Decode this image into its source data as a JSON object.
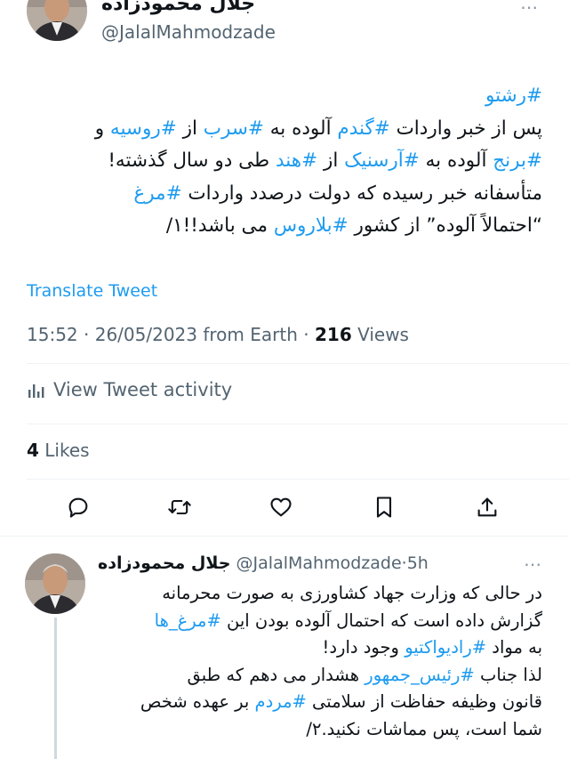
{
  "main_tweet": {
    "author_name": "جلال محمودزاده",
    "author_handle": "@JalalMahmodzade",
    "body_lines": [
      [
        {
          "t": "#رشتو",
          "tag": true
        }
      ],
      [
        {
          "t": "پس از خبر واردات "
        },
        {
          "t": "#گندم",
          "tag": true
        },
        {
          "t": " آلوده به "
        },
        {
          "t": "#سرب",
          "tag": true
        },
        {
          "t": " از "
        },
        {
          "t": "#روسیه",
          "tag": true
        },
        {
          "t": " و"
        }
      ],
      [
        {
          "t": "#برنج",
          "tag": true
        },
        {
          "t": " آلوده به "
        },
        {
          "t": "#آرسنیک",
          "tag": true
        },
        {
          "t": " از "
        },
        {
          "t": "#هند",
          "tag": true
        },
        {
          "t": " طی دو سال گذشته!"
        }
      ],
      [
        {
          "t": "متأسفانه خبر رسیده که دولت درصدد واردات "
        },
        {
          "t": "#مرغ",
          "tag": true
        }
      ],
      [
        {
          "t": "“احتمالاً آلوده” از کشور "
        },
        {
          "t": "#بلاروس",
          "tag": true
        },
        {
          "t": " می باشد!!۱/"
        }
      ]
    ],
    "translate_label": "Translate Tweet",
    "time": "15:52",
    "date": "26/05/2023",
    "source": "from Earth",
    "views_count": "216",
    "views_label": "Views",
    "activity_label": "View Tweet activity",
    "likes_count": "4",
    "likes_label": "Likes"
  },
  "actions": [
    "reply-icon",
    "retweet-icon",
    "like-icon",
    "bookmark-icon",
    "share-icon"
  ],
  "reply_tweet": {
    "author_name": "جلال محمودزاده",
    "author_handle": "@JalalMahmodzade",
    "time_ago": "5h",
    "body_lines": [
      [
        {
          "t": "در حالی که وزارت جهاد کشاورزی به صورت محرمانه"
        }
      ],
      [
        {
          "t": "گزارش داده است که احتمال آلوده بودن این "
        },
        {
          "t": "#مرغ_ها",
          "tag": true
        }
      ],
      [
        {
          "t": "به مواد "
        },
        {
          "t": "#رادیواکتیو",
          "tag": true
        },
        {
          "t": " وجود دارد!"
        }
      ],
      [
        {
          "t": "لذا جناب "
        },
        {
          "t": "#رئیس_جمهور",
          "tag": true
        },
        {
          "t": " هشدار می دهم که طبق"
        }
      ],
      [
        {
          "t": "قانون وظیفه حفاظت از سلامتی "
        },
        {
          "t": "#مردم",
          "tag": true
        },
        {
          "t": " بر عهده شخص"
        }
      ],
      [
        {
          "t": "شما است، پس مماشات نکنید.۲/"
        }
      ]
    ]
  },
  "colors": {
    "text": "#0f1419",
    "secondary": "#536471",
    "accent": "#1d9bf0",
    "divider": "#eff3f4",
    "thread_line": "#cfd9de"
  }
}
